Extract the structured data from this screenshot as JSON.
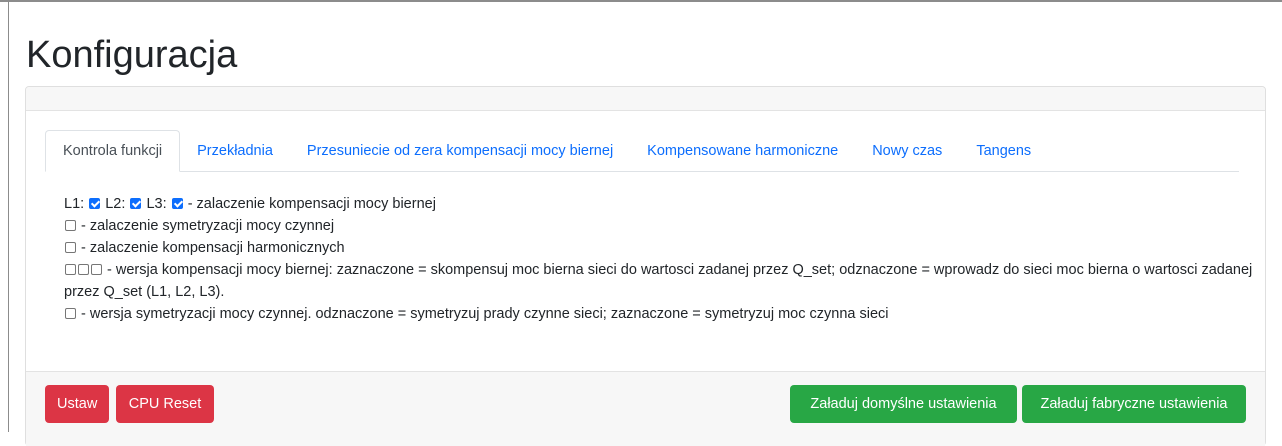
{
  "page": {
    "title": "Konfiguracja"
  },
  "tabs": [
    {
      "label": "Kontrola funkcji",
      "active": true
    },
    {
      "label": "Przekładnia",
      "active": false
    },
    {
      "label": "Przesuniecie od zera kompensacji mocy biernej",
      "active": false
    },
    {
      "label": "Kompensowane harmoniczne",
      "active": false
    },
    {
      "label": "Nowy czas",
      "active": false
    },
    {
      "label": "Tangens",
      "active": false
    }
  ],
  "content": {
    "row1": {
      "l1_label": "L1:",
      "l1_checked": true,
      "l2_label": "L2:",
      "l2_checked": true,
      "l3_label": "L3:",
      "l3_checked": true,
      "text": "- zalaczenie kompensacji mocy biernej"
    },
    "row2": {
      "checked": false,
      "text": "- zalaczenie symetryzacji mocy czynnej"
    },
    "row3": {
      "checked": false,
      "text": "- zalaczenie kompensacji harmonicznych"
    },
    "row4": {
      "checkboxes": [
        false,
        false,
        false
      ],
      "text": "- wersja kompensacji mocy biernej: zaznaczone = skompensuj moc bierna sieci do wartosci zadanej przez Q_set; odznaczone = wprowadz do sieci moc bierna o wartosci zadanej przez Q_set (L1, L2, L3)."
    },
    "row5": {
      "checked": false,
      "text": "- wersja symetryzacji mocy czynnej. odznaczone = symetryzuj prady czynne sieci; zaznaczone = symetryzuj moc czynna sieci"
    }
  },
  "footer": {
    "set_label": "Ustaw",
    "cpu_reset_label": "CPU Reset",
    "load_default_label": "Załaduj domyślne ustawienia",
    "load_factory_label": "Załaduj fabryczne ustawienia"
  },
  "colors": {
    "primary": "#0d6efd",
    "danger": "#dc3545",
    "success": "#28a745"
  }
}
